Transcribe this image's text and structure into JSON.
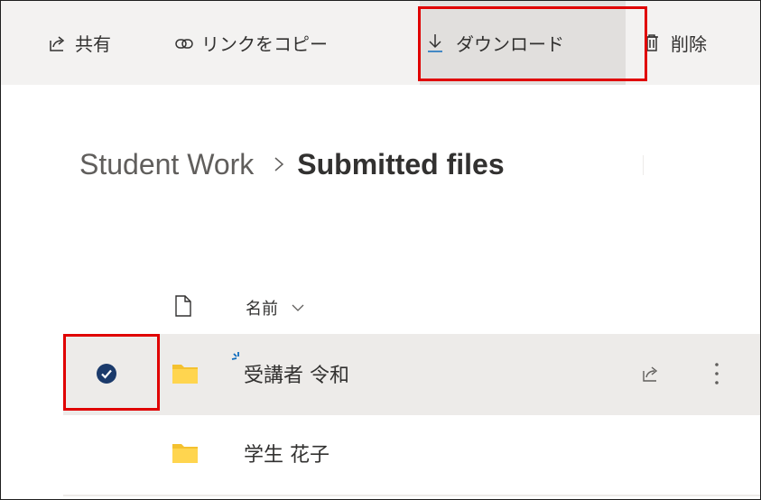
{
  "command_bar": {
    "share_label": "共有",
    "share_icon": "share-icon",
    "copy_link_label": "リンクをコピー",
    "copy_link_icon": "link-icon",
    "download_label": "ダウンロード",
    "download_icon": "download-icon",
    "delete_label": "削除",
    "delete_icon": "trash-icon"
  },
  "breadcrumb": {
    "root": "Student Work",
    "current": "Submitted files"
  },
  "list": {
    "column_header": "名前",
    "rows": [
      {
        "name": "受講者 令和",
        "selected": true,
        "new": true,
        "icon": "folder-icon"
      },
      {
        "name": "学生 花子",
        "selected": false,
        "new": false,
        "icon": "folder-icon"
      }
    ]
  },
  "colors": {
    "accent": "#0f6cbd",
    "check_fill": "#1b3a6b",
    "folder": "#ffd54f",
    "highlight_box": "#e00000",
    "selected_row": "#edebe9"
  }
}
